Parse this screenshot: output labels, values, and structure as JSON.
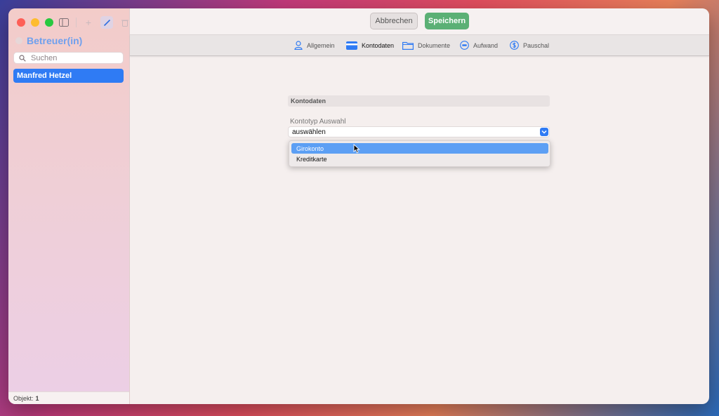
{
  "sidebar": {
    "title": "Betreuer(in)",
    "search_placeholder": "Suchen",
    "items": [
      {
        "label": "Manfred Hetzel",
        "selected": true
      }
    ],
    "footer_label": "Objekt:",
    "footer_count": "1"
  },
  "toolbar": {
    "cancel_label": "Abbrechen",
    "save_label": "Speichern"
  },
  "tabs": [
    {
      "label": "Allgemein",
      "icon": "person-icon"
    },
    {
      "label": "Kontodaten",
      "icon": "credit-card-icon",
      "active": true
    },
    {
      "label": "Dokumente",
      "icon": "folder-icon"
    },
    {
      "label": "Aufwand",
      "icon": "badge-icon"
    },
    {
      "label": "Pauschal",
      "icon": "dollar-circle-icon"
    }
  ],
  "form": {
    "section_title": "Kontodaten",
    "field_label": "Kontotyp Auswahl",
    "select_value": "auswählen",
    "options": [
      "Girokonto",
      "Kreditkarte"
    ],
    "highlighted_option": "Girokonto"
  },
  "colors": {
    "accent": "#2f7bf4",
    "save_green": "#5bb075",
    "highlight": "#5c9ff4"
  }
}
